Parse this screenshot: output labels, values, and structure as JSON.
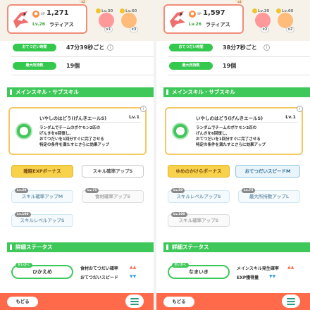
{
  "panels": [
    {
      "header": {
        "energy": "1,271",
        "sp_label": "SP",
        "level": "Lv.26",
        "name": "ラティアス",
        "berries": [
          {
            "level": "Lv.30",
            "count": "x1"
          },
          {
            "level": "Lv.60",
            "count": "x3"
          }
        ],
        "tabs": [
          "x2",
          "x3"
        ]
      },
      "stats": [
        {
          "label": "おてつだい時間",
          "value": "47分39秒ごと"
        },
        {
          "label": "最大所持数",
          "value": "19個"
        }
      ],
      "skill_section_title": "メインスキル・サブスキル",
      "skill": {
        "name": "いやしのはどう(げんきエールS)",
        "level": "Lv.1",
        "description": [
          "ランダムでチームのポケモン2匹の",
          "げんきを6回復し、",
          "おてつだいを1回分すぐに完了させる",
          "特定の条件を満たすとさらに効果アップ"
        ]
      },
      "subskills": [
        {
          "label": "睡眠EXPボーナス",
          "unlock": ""
        },
        {
          "label": "スキル確率アップS",
          "unlock": ""
        },
        {
          "label": "スキル確率アップM",
          "unlock": "Lv.50"
        },
        {
          "label": "食材確率アップS",
          "unlock": "Lv.75"
        },
        {
          "label": "スキルレベルアップS",
          "unlock": "Lv.100"
        }
      ],
      "detail_section_title": "詳細ステータス",
      "nature": {
        "tag": "せいかく",
        "name": "ひかえめ"
      },
      "effects": [
        {
          "label": "食材おてつだい確率",
          "arrow": "▲▲"
        },
        {
          "label": "おてつだいスピード",
          "arrow": "▼▼"
        }
      ],
      "bottom": {
        "back": "もどる"
      }
    },
    {
      "header": {
        "energy": "1,597",
        "sp_label": "SP",
        "level": "Lv.26",
        "name": "ラティアス",
        "berries": [
          {
            "level": "Lv.30",
            "count": "x2"
          },
          {
            "level": "Lv.60",
            "count": "x2"
          }
        ],
        "tabs": [
          "x1",
          "x1"
        ]
      },
      "stats": [
        {
          "label": "おてつだい時間",
          "value": "38分7秒ごと"
        },
        {
          "label": "最大所持数",
          "value": "19個"
        }
      ],
      "skill_section_title": "メインスキル・サブスキル",
      "skill": {
        "name": "いやしのはどう(げんきエールS)",
        "level": "Lv.1",
        "description": [
          "ランダムでチームのポケモン2匹の",
          "げんきを6回復し、",
          "おてつだいを1回分すぐに完了させる",
          "特定の条件を満たすとさらに効果アップ"
        ]
      },
      "subskills": [
        {
          "label": "ゆめのかけらボーナス",
          "unlock": ""
        },
        {
          "label": "おてつだいスピードM",
          "unlock": ""
        },
        {
          "label": "スキルレベルアップS",
          "unlock": "Lv.50"
        },
        {
          "label": "最大所持数アップL",
          "unlock": "Lv.75"
        },
        {
          "label": "スキル確率アップS",
          "unlock": "Lv.100"
        }
      ],
      "detail_section_title": "詳細ステータス",
      "nature": {
        "tag": "せいかく",
        "name": "なまいき"
      },
      "effects": [
        {
          "label": "メインスキル発生確率",
          "arrow": "▲▲"
        },
        {
          "label": "EXP獲得量",
          "arrow": "▼▼"
        }
      ],
      "bottom": {
        "back": "もどる"
      }
    }
  ],
  "colors": {
    "green": "#3fc85a",
    "gold": "#f7d24a",
    "coral": "#ff6a4a",
    "up": "#ff6a4a",
    "down": "#3aa0e0"
  }
}
